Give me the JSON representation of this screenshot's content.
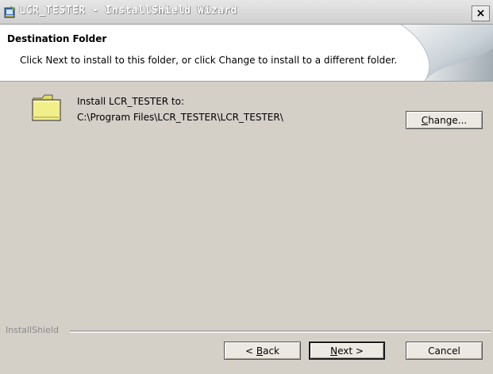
{
  "window": {
    "title": "LCR_TESTER - InstallShield Wizard",
    "close_glyph": "×",
    "icon": "installer-icon"
  },
  "header": {
    "title": "Destination Folder",
    "subtitle": "Click Next to install to this folder, or click Change to install to a different folder.",
    "art": "page-curl-graphic"
  },
  "destination": {
    "icon": "folder-icon",
    "label": "Install LCR_TESTER to:",
    "path": "C:\\Program Files\\LCR_TESTER\\LCR_TESTER\\",
    "change_button": {
      "mnemonic": "C",
      "rest": "hange..."
    }
  },
  "footer": {
    "brand": "InstallShield",
    "back_button": {
      "prefix": "< ",
      "mnemonic": "B",
      "rest": "ack"
    },
    "next_button": {
      "mnemonic": "N",
      "rest": "ext >"
    },
    "cancel_button": "Cancel"
  },
  "colors": {
    "dialog_background": "#d4d0c8",
    "header_background": "#ffffff",
    "folder_yellow": "#f2ef8a"
  }
}
